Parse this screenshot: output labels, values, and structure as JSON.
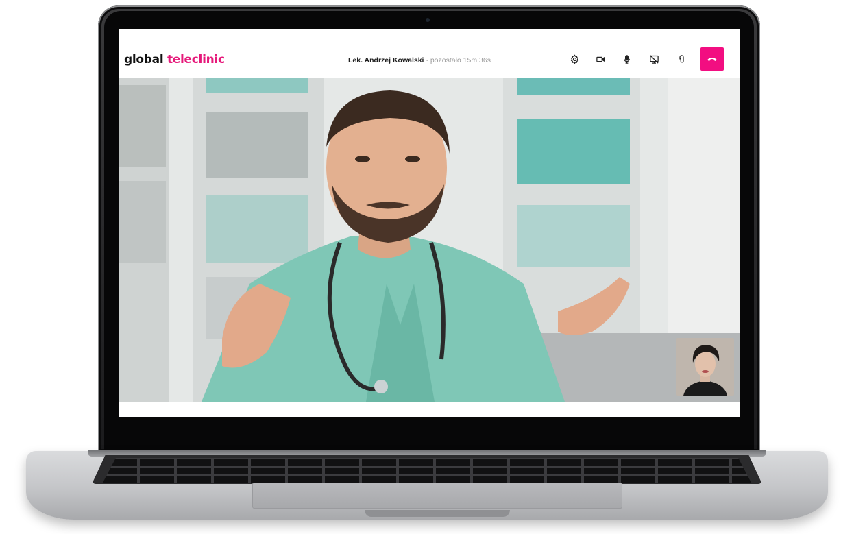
{
  "app": {
    "logo": {
      "part1": "global",
      "part2": "teleclinic"
    },
    "brand_color": "#e6197a",
    "end_call_color": "#f20e81"
  },
  "session": {
    "doctor_name": "Lek. Andrzej Kowalski",
    "time_remaining": "· pozostało 15m 36s"
  },
  "toolbar": {
    "buttons": [
      {
        "name": "settings",
        "icon": "gear-icon"
      },
      {
        "name": "camera",
        "icon": "video-camera-icon"
      },
      {
        "name": "microphone",
        "icon": "microphone-icon"
      },
      {
        "name": "screen-share-off",
        "icon": "screen-share-off-icon"
      },
      {
        "name": "attachment",
        "icon": "paperclip-icon"
      },
      {
        "name": "end-call",
        "icon": "phone-hangup-icon"
      }
    ]
  },
  "video": {
    "remote": "doctor in mint-green scrubs with stethoscope, gesturing with both hands",
    "self_view": "woman with short dark hair"
  }
}
